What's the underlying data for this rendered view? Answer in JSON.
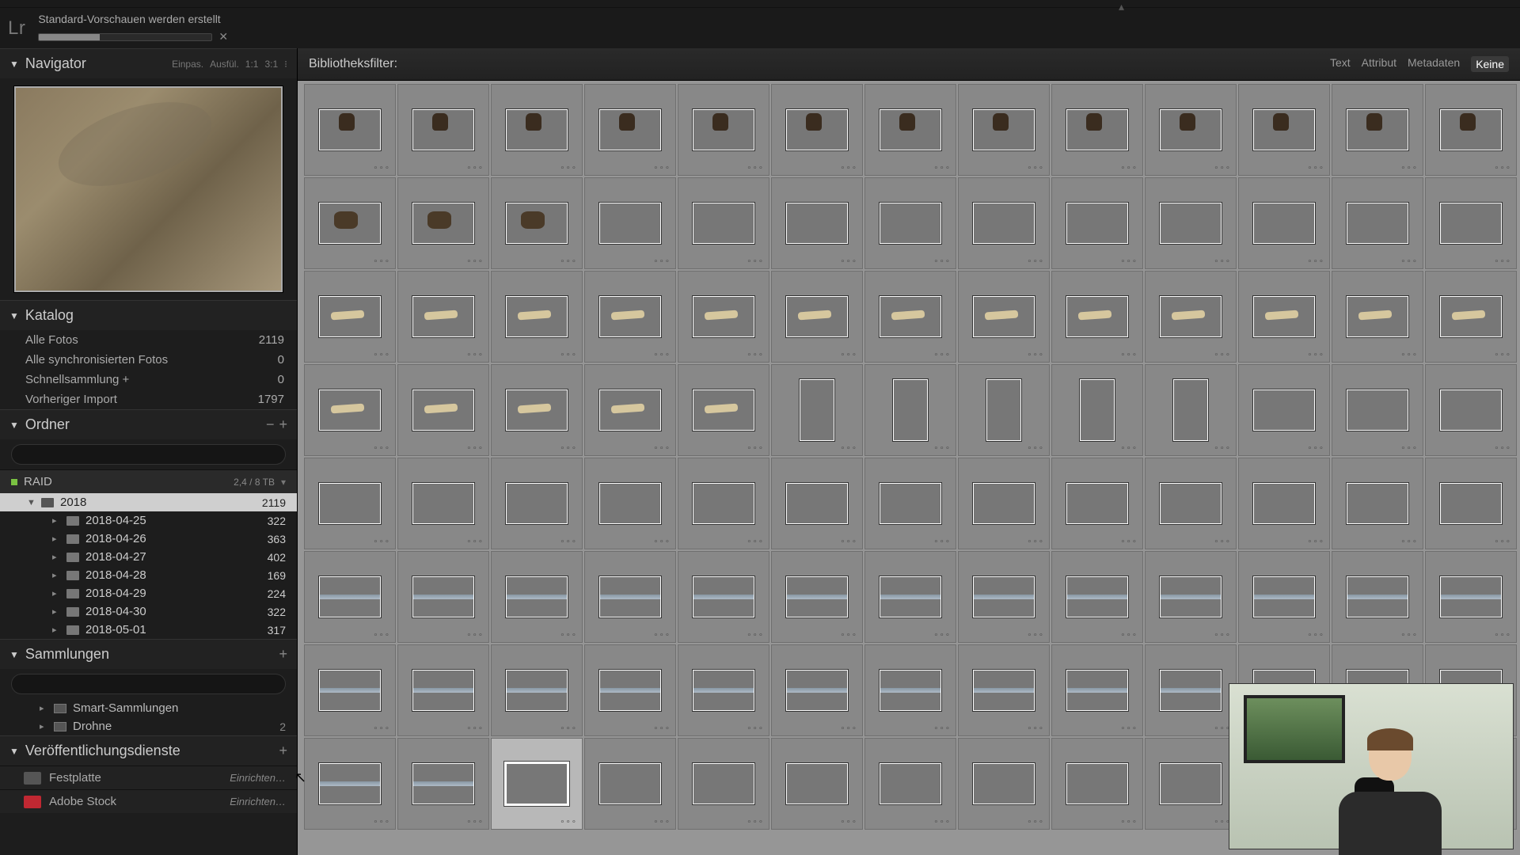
{
  "app": {
    "logo": "Lr"
  },
  "progress": {
    "label": "Standard-Vorschauen werden erstellt",
    "percent": 35
  },
  "navigator": {
    "title": "Navigator",
    "opts": [
      "Einpas.",
      "Ausfül.",
      "1:1",
      "3:1"
    ]
  },
  "catalog": {
    "title": "Katalog",
    "rows": [
      {
        "label": "Alle Fotos",
        "count": "2119"
      },
      {
        "label": "Alle synchronisierten Fotos",
        "count": "0"
      },
      {
        "label": "Schnellsammlung  +",
        "count": "0"
      },
      {
        "label": "Vorheriger Import",
        "count": "1797"
      }
    ]
  },
  "folders": {
    "title": "Ordner",
    "volume": {
      "name": "RAID",
      "capacity": "2,4 / 8 TB"
    },
    "year": {
      "name": "2018",
      "count": "2119"
    },
    "dates": [
      {
        "name": "2018-04-25",
        "count": "322"
      },
      {
        "name": "2018-04-26",
        "count": "363"
      },
      {
        "name": "2018-04-27",
        "count": "402"
      },
      {
        "name": "2018-04-28",
        "count": "169"
      },
      {
        "name": "2018-04-29",
        "count": "224"
      },
      {
        "name": "2018-04-30",
        "count": "322"
      },
      {
        "name": "2018-05-01",
        "count": "317"
      }
    ]
  },
  "collections": {
    "title": "Sammlungen",
    "items": [
      {
        "label": "Smart-Sammlungen",
        "count": ""
      },
      {
        "label": "Drohne",
        "count": "2"
      }
    ]
  },
  "publish": {
    "title": "Veröffentlichungsdienste",
    "services": [
      {
        "label": "Festplatte",
        "action": "Einrichten…"
      },
      {
        "label": "Adobe Stock",
        "action": "Einrichten…"
      }
    ]
  },
  "filterbar": {
    "label": "Bibliotheksfilter:",
    "opts": {
      "text": "Text",
      "attr": "Attribut",
      "meta": "Metadaten",
      "none": "Keine"
    }
  },
  "grid": {
    "rows": [
      [
        "road",
        "road",
        "road",
        "road",
        "road",
        "road",
        "road",
        "road",
        "road",
        "road",
        "road",
        "road",
        "road"
      ],
      [
        "cow",
        "cow",
        "cow",
        "dark",
        "dark",
        "dusk",
        "dark",
        "dark",
        "dark",
        "dusk",
        "dusk",
        "dusk",
        "dark"
      ],
      [
        "boat",
        "boat",
        "boat",
        "boat",
        "boat",
        "boat",
        "boat",
        "boat",
        "boat",
        "boat",
        "boat",
        "boat",
        "boat"
      ],
      [
        "boat",
        "boat",
        "boat",
        "boat",
        "boat",
        "pierv",
        "pierv",
        "pierv",
        "pierv",
        "pierv",
        "lake",
        "lake",
        "lake"
      ],
      [
        "lake",
        "lake",
        "lake",
        "lake",
        "lake",
        "lake",
        "lake",
        "lake",
        "lake",
        "lake",
        "lake",
        "lake",
        "lake"
      ],
      [
        "lakeref",
        "lakeref",
        "lakeref",
        "lakeref",
        "lakeref",
        "lakeref",
        "lakeref",
        "lakeref",
        "lakeref",
        "lakeref",
        "lakeref",
        "lakeref",
        "lakeref"
      ],
      [
        "lakeref",
        "lakeref",
        "lakeref",
        "lakeref",
        "lakeref",
        "lakeref",
        "lakeref",
        "lakeref",
        "lakeref",
        "lakeref",
        "lakeref",
        "lakeref",
        "lakeref"
      ],
      [
        "lakeref",
        "lakeref",
        "dirt",
        "bright",
        "bright",
        "bright",
        "bright",
        "bright",
        "bright",
        "bright",
        "bright",
        "bright",
        "bright"
      ]
    ],
    "selected": {
      "row": 7,
      "col": 2
    }
  }
}
